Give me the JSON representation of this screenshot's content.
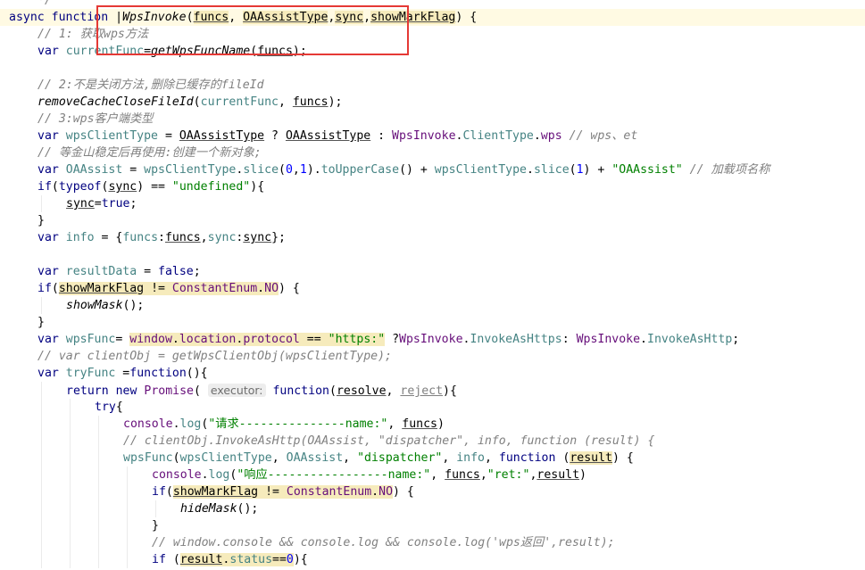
{
  "editor": {
    "colors": {
      "keyword": "#000080",
      "string": "#008000",
      "number": "#0000ff",
      "comment": "#808080",
      "field": "#458383",
      "global": "#660e7a",
      "current_line": "#fffae3",
      "highlight": "#f6ebbc",
      "annotation": "#e53935"
    },
    "lines": [
      {
        "indent": 1,
        "tokens": [
          {
            "t": "*/",
            "k": "cm"
          }
        ]
      },
      {
        "indent": 0,
        "current": true,
        "tokens": [
          {
            "t": "async",
            "k": "kw"
          },
          {
            "t": " "
          },
          {
            "t": "function",
            "k": "kw"
          },
          {
            "t": " "
          },
          {
            "t": "|",
            "k": "caret"
          },
          {
            "t": "WpsInvoke",
            "k": "fn"
          },
          {
            "t": "("
          },
          {
            "t": "funcs",
            "k": "param",
            "hl": true
          },
          {
            "t": ", "
          },
          {
            "t": "OAAssistType",
            "k": "param",
            "hl": true
          },
          {
            "t": ","
          },
          {
            "t": "sync",
            "k": "param",
            "hl": true
          },
          {
            "t": ","
          },
          {
            "t": "showMarkFlag",
            "k": "param",
            "hl": true
          },
          {
            "t": ") {"
          }
        ]
      },
      {
        "indent": 1,
        "tokens": [
          {
            "t": "// 1: 获取wps方法",
            "k": "cm"
          }
        ]
      },
      {
        "indent": 1,
        "tokens": [
          {
            "t": "var",
            "k": "kw"
          },
          {
            "t": " "
          },
          {
            "t": "currentFunc",
            "k": "var"
          },
          {
            "t": "="
          },
          {
            "t": "getWpsFuncName",
            "k": "fn"
          },
          {
            "t": "("
          },
          {
            "t": "funcs",
            "k": "param"
          },
          {
            "t": ");"
          }
        ]
      },
      {
        "indent": 0,
        "tokens": []
      },
      {
        "indent": 1,
        "tokens": [
          {
            "t": "// 2:不是关闭方法,删除已缓存的fileId",
            "k": "cm"
          }
        ]
      },
      {
        "indent": 1,
        "tokens": [
          {
            "t": "removeCacheCloseFileId",
            "k": "fn"
          },
          {
            "t": "("
          },
          {
            "t": "currentFunc",
            "k": "var"
          },
          {
            "t": ", "
          },
          {
            "t": "funcs",
            "k": "param"
          },
          {
            "t": ");"
          }
        ]
      },
      {
        "indent": 1,
        "tokens": [
          {
            "t": "// 3:wps客户端类型",
            "k": "cm"
          }
        ]
      },
      {
        "indent": 1,
        "tokens": [
          {
            "t": "var",
            "k": "kw"
          },
          {
            "t": " "
          },
          {
            "t": "wpsClientType",
            "k": "var"
          },
          {
            "t": " = "
          },
          {
            "t": "OAAssistType",
            "k": "param"
          },
          {
            "t": " ? "
          },
          {
            "t": "OAAssistType",
            "k": "param"
          },
          {
            "t": " : "
          },
          {
            "t": "WpsInvoke",
            "k": "global"
          },
          {
            "t": "."
          },
          {
            "t": "ClientType",
            "k": "field"
          },
          {
            "t": "."
          },
          {
            "t": "wps",
            "k": "global"
          },
          {
            "t": " "
          },
          {
            "t": "// wps、et",
            "k": "cm"
          }
        ]
      },
      {
        "indent": 1,
        "tokens": [
          {
            "t": "// 等金山稳定后再使用:创建一个新对象;",
            "k": "cm"
          }
        ]
      },
      {
        "indent": 1,
        "tokens": [
          {
            "t": "var",
            "k": "kw"
          },
          {
            "t": " "
          },
          {
            "t": "OAAssist",
            "k": "var"
          },
          {
            "t": " = "
          },
          {
            "t": "wpsClientType",
            "k": "var"
          },
          {
            "t": "."
          },
          {
            "t": "slice",
            "k": "field"
          },
          {
            "t": "("
          },
          {
            "t": "0",
            "k": "num"
          },
          {
            "t": ","
          },
          {
            "t": "1",
            "k": "num"
          },
          {
            "t": ")."
          },
          {
            "t": "toUpperCase",
            "k": "field"
          },
          {
            "t": "() + "
          },
          {
            "t": "wpsClientType",
            "k": "var"
          },
          {
            "t": "."
          },
          {
            "t": "slice",
            "k": "field"
          },
          {
            "t": "("
          },
          {
            "t": "1",
            "k": "num"
          },
          {
            "t": ") + "
          },
          {
            "t": "\"OAAssist\"",
            "k": "str"
          },
          {
            "t": " "
          },
          {
            "t": "// 加载项名称",
            "k": "cm"
          }
        ]
      },
      {
        "indent": 1,
        "tokens": [
          {
            "t": "if",
            "k": "kw"
          },
          {
            "t": "("
          },
          {
            "t": "typeof",
            "k": "kw"
          },
          {
            "t": "("
          },
          {
            "t": "sync",
            "k": "param"
          },
          {
            "t": ") == "
          },
          {
            "t": "\"undefined\"",
            "k": "str"
          },
          {
            "t": "){"
          }
        ]
      },
      {
        "indent": 2,
        "tokens": [
          {
            "t": "sync",
            "k": "param"
          },
          {
            "t": "="
          },
          {
            "t": "true",
            "k": "kw"
          },
          {
            "t": ";"
          }
        ]
      },
      {
        "indent": 1,
        "tokens": [
          {
            "t": "}"
          }
        ]
      },
      {
        "indent": 1,
        "tokens": [
          {
            "t": "var",
            "k": "kw"
          },
          {
            "t": " "
          },
          {
            "t": "info",
            "k": "var"
          },
          {
            "t": " = {"
          },
          {
            "t": "funcs",
            "k": "field"
          },
          {
            "t": ":"
          },
          {
            "t": "funcs",
            "k": "param"
          },
          {
            "t": ","
          },
          {
            "t": "sync",
            "k": "field"
          },
          {
            "t": ":"
          },
          {
            "t": "sync",
            "k": "param"
          },
          {
            "t": "};"
          }
        ]
      },
      {
        "indent": 0,
        "tokens": []
      },
      {
        "indent": 1,
        "tokens": [
          {
            "t": "var",
            "k": "kw"
          },
          {
            "t": " "
          },
          {
            "t": "resultData",
            "k": "var"
          },
          {
            "t": " = "
          },
          {
            "t": "false",
            "k": "kw"
          },
          {
            "t": ";"
          }
        ]
      },
      {
        "indent": 1,
        "tokens": [
          {
            "t": "if",
            "k": "kw"
          },
          {
            "t": "("
          },
          {
            "t": "showMarkFlag",
            "k": "param",
            "hl": true
          },
          {
            "t": " != ",
            "hl": true
          },
          {
            "t": "ConstantEnum",
            "k": "global",
            "hl": true
          },
          {
            "t": ".",
            "hl": true
          },
          {
            "t": "NO",
            "k": "global",
            "hl": true
          },
          {
            "t": ") {"
          }
        ]
      },
      {
        "indent": 2,
        "tokens": [
          {
            "t": "showMask",
            "k": "fn"
          },
          {
            "t": "();"
          }
        ]
      },
      {
        "indent": 1,
        "tokens": [
          {
            "t": "}"
          }
        ]
      },
      {
        "indent": 1,
        "tokens": [
          {
            "t": "var",
            "k": "kw"
          },
          {
            "t": " "
          },
          {
            "t": "wpsFunc",
            "k": "var"
          },
          {
            "t": "= "
          },
          {
            "t": "window",
            "k": "global",
            "hl": true
          },
          {
            "t": ".",
            "hl": true
          },
          {
            "t": "location",
            "k": "global",
            "hl": true
          },
          {
            "t": ".",
            "hl": true
          },
          {
            "t": "protocol",
            "k": "global",
            "hl": true
          },
          {
            "t": " == ",
            "hl": true
          },
          {
            "t": "\"https:\"",
            "k": "str",
            "hl": true
          },
          {
            "t": " ?"
          },
          {
            "t": "WpsInvoke",
            "k": "global"
          },
          {
            "t": "."
          },
          {
            "t": "InvokeAsHttps",
            "k": "field"
          },
          {
            "t": ": "
          },
          {
            "t": "WpsInvoke",
            "k": "global"
          },
          {
            "t": "."
          },
          {
            "t": "InvokeAsHttp",
            "k": "field"
          },
          {
            "t": ";"
          }
        ]
      },
      {
        "indent": 1,
        "tokens": [
          {
            "t": "// var clientObj = getWpsClientObj(wpsClientType);",
            "k": "cm"
          }
        ]
      },
      {
        "indent": 1,
        "tokens": [
          {
            "t": "var",
            "k": "kw"
          },
          {
            "t": " "
          },
          {
            "t": "tryFunc",
            "k": "var"
          },
          {
            "t": " ="
          },
          {
            "t": "function",
            "k": "kw"
          },
          {
            "t": "(){"
          }
        ]
      },
      {
        "indent": 2,
        "tokens": [
          {
            "t": "return",
            "k": "kw"
          },
          {
            "t": " "
          },
          {
            "t": "new",
            "k": "kw"
          },
          {
            "t": " "
          },
          {
            "t": "Promise",
            "k": "global"
          },
          {
            "t": "( "
          },
          {
            "t": "executor:",
            "k": "hint"
          },
          {
            "t": " "
          },
          {
            "t": "function",
            "k": "kw"
          },
          {
            "t": "("
          },
          {
            "t": "resolve",
            "k": "param"
          },
          {
            "t": ", "
          },
          {
            "t": "reject",
            "k": "unused"
          },
          {
            "t": "){"
          }
        ]
      },
      {
        "indent": 3,
        "tokens": [
          {
            "t": "try",
            "k": "kw"
          },
          {
            "t": "{"
          }
        ]
      },
      {
        "indent": 4,
        "tokens": [
          {
            "t": "console",
            "k": "global"
          },
          {
            "t": "."
          },
          {
            "t": "log",
            "k": "field"
          },
          {
            "t": "("
          },
          {
            "t": "\"请求---------------name:\"",
            "k": "str"
          },
          {
            "t": ", "
          },
          {
            "t": "funcs",
            "k": "param"
          },
          {
            "t": ")"
          }
        ]
      },
      {
        "indent": 4,
        "tokens": [
          {
            "t": "// clientObj.InvokeAsHttp(OAAssist, \"dispatcher\", info, function (result) {",
            "k": "cm"
          }
        ]
      },
      {
        "indent": 4,
        "tokens": [
          {
            "t": "wpsFunc",
            "k": "var"
          },
          {
            "t": "("
          },
          {
            "t": "wpsClientType",
            "k": "var"
          },
          {
            "t": ", "
          },
          {
            "t": "OAAssist",
            "k": "var"
          },
          {
            "t": ", "
          },
          {
            "t": "\"dispatcher\"",
            "k": "str"
          },
          {
            "t": ", "
          },
          {
            "t": "info",
            "k": "var"
          },
          {
            "t": ", "
          },
          {
            "t": "function",
            "k": "kw"
          },
          {
            "t": " ("
          },
          {
            "t": "result",
            "k": "param",
            "hl": true
          },
          {
            "t": ") {"
          }
        ]
      },
      {
        "indent": 5,
        "tokens": [
          {
            "t": "console",
            "k": "global"
          },
          {
            "t": "."
          },
          {
            "t": "log",
            "k": "field"
          },
          {
            "t": "("
          },
          {
            "t": "\"响应-----------------name:\"",
            "k": "str"
          },
          {
            "t": ", "
          },
          {
            "t": "funcs",
            "k": "param"
          },
          {
            "t": ","
          },
          {
            "t": "\"ret:\"",
            "k": "str"
          },
          {
            "t": ","
          },
          {
            "t": "result",
            "k": "param"
          },
          {
            "t": ")"
          }
        ]
      },
      {
        "indent": 5,
        "tokens": [
          {
            "t": "if",
            "k": "kw"
          },
          {
            "t": "("
          },
          {
            "t": "showMarkFlag",
            "k": "param",
            "hl": true
          },
          {
            "t": " != ",
            "hl": true
          },
          {
            "t": "ConstantEnum",
            "k": "global",
            "hl": true
          },
          {
            "t": ".",
            "hl": true
          },
          {
            "t": "NO",
            "k": "global",
            "hl": true
          },
          {
            "t": ") {"
          }
        ]
      },
      {
        "indent": 6,
        "tokens": [
          {
            "t": "hideMask",
            "k": "fn"
          },
          {
            "t": "();"
          }
        ]
      },
      {
        "indent": 5,
        "tokens": [
          {
            "t": "}"
          }
        ]
      },
      {
        "indent": 5,
        "tokens": [
          {
            "t": "// window.console && console.log && console.log('wps返回',result);",
            "k": "cm"
          }
        ]
      },
      {
        "indent": 5,
        "tokens": [
          {
            "t": "if",
            "k": "kw"
          },
          {
            "t": " ("
          },
          {
            "t": "result",
            "k": "param",
            "hl": true
          },
          {
            "t": ".",
            "hl": true
          },
          {
            "t": "status",
            "k": "field",
            "hl": true
          },
          {
            "t": "==",
            "hl": true
          },
          {
            "t": "0",
            "k": "num",
            "hl": true
          },
          {
            "t": "){"
          }
        ]
      }
    ]
  }
}
